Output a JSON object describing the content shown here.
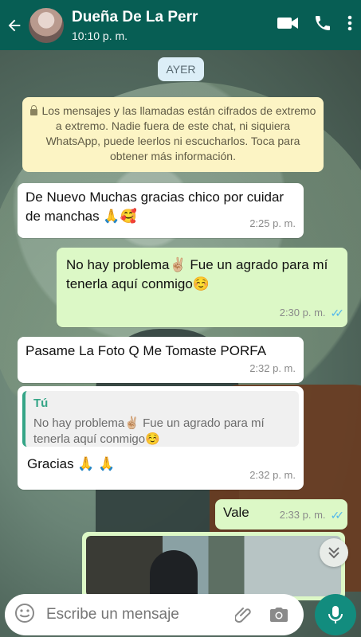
{
  "header": {
    "title": "Dueña De La Perr",
    "subtitle": "10:10 p. m."
  },
  "chat": {
    "date_label": "AYER",
    "encryption_notice": "Los mensajes y las llamadas están cifrados de extremo a extremo. Nadie fuera de este chat, ni siquiera WhatsApp, puede leerlos ni escucharlos. Toca para obtener más información.",
    "messages": [
      {
        "direction": "in",
        "text": "De Nuevo Muchas gracias chico por cuidar de manchas 🙏🥰",
        "time": "2:25 p. m."
      },
      {
        "direction": "out",
        "text": "No hay problema✌🏼 Fue un agrado para mí tenerla aquí conmigo☺️",
        "time": "2:30 p. m.",
        "status": "read"
      },
      {
        "direction": "in",
        "text": "Pasame La Foto Q Me Tomaste PORFA",
        "time": "2:32 p. m."
      },
      {
        "direction": "in",
        "reply_author": "Tú",
        "reply_text": "No hay problema✌🏼 Fue un agrado para mí tenerla aquí conmigo☺️",
        "text": "Gracias 🙏 🙏",
        "time": "2:32 p. m."
      },
      {
        "direction": "out",
        "text": "Vale",
        "time": "2:33 p. m.",
        "status": "read"
      }
    ]
  },
  "input": {
    "placeholder": "Escribe un mensaje"
  },
  "icons": {
    "back": "arrow-left-icon",
    "video": "video-call-icon",
    "call": "phone-icon",
    "menu": "more-vert-icon",
    "emoji": "emoji-icon",
    "attach": "paperclip-icon",
    "camera": "camera-icon",
    "mic": "mic-icon",
    "scroll": "chevron-double-down-icon"
  },
  "colors": {
    "header": "#075e54",
    "outgoing_bubble": "#dcf8c6",
    "incoming_bubble": "#ffffff",
    "notice_bg": "#fcf4c4",
    "read_ticks": "#4fb6ec",
    "mic_button": "#128c7e"
  }
}
